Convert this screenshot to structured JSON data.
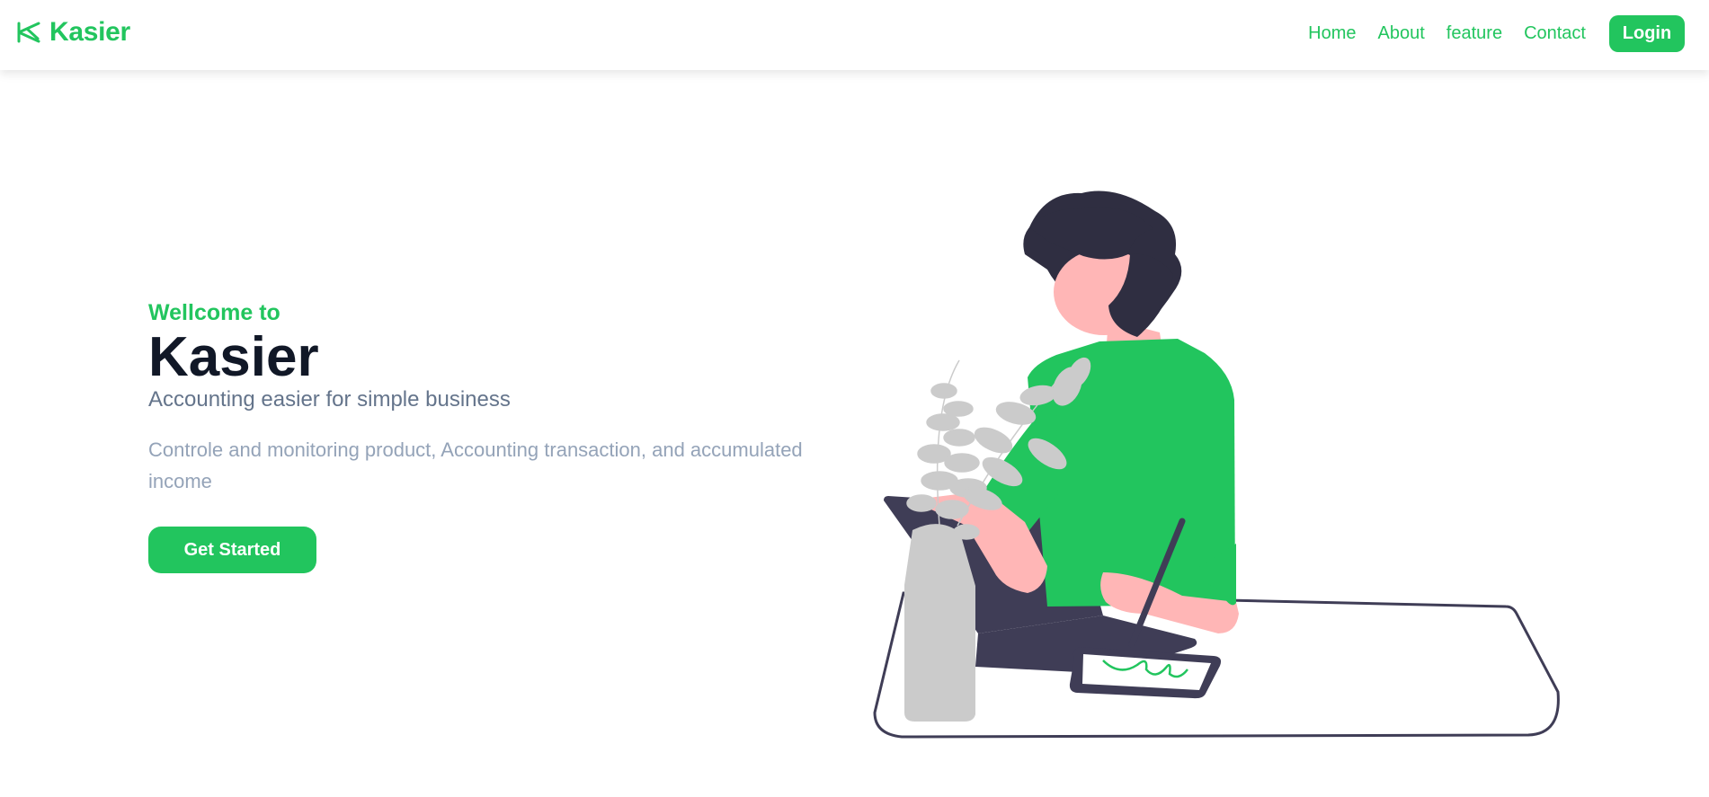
{
  "navbar": {
    "brand": "Kasier",
    "brand_icon": "kasier-logo-icon",
    "links": [
      "Home",
      "About",
      "feature",
      "Contact"
    ],
    "login_label": "Login"
  },
  "hero": {
    "welcome": "Wellcome to",
    "title": "Kasier",
    "subtitle": "Accounting easier for simple business",
    "description": "Controle and monitoring product, Accounting transaction, and accumulated income",
    "cta_label": "Get Started"
  },
  "colors": {
    "accent": "#22c55e",
    "title": "#111827",
    "subtitle": "#64748b",
    "description": "#94a3b8",
    "illustration_dark": "#3f3d56",
    "illustration_hair": "#2f2e41",
    "illustration_skin": "#ffb6b6",
    "illustration_plant": "#cbcbcb"
  }
}
